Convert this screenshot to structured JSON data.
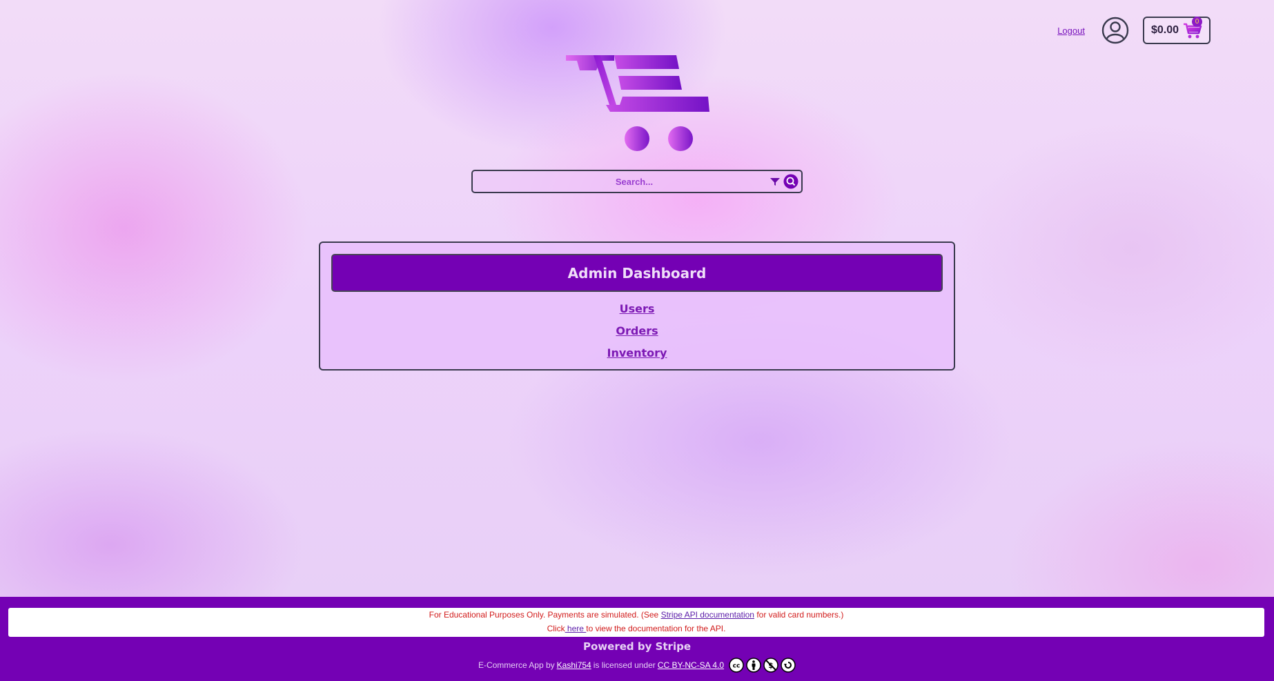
{
  "header": {
    "logout_label": "Logout",
    "cart_total": "$0.00",
    "cart_count": "0"
  },
  "search": {
    "placeholder": "Search..."
  },
  "dashboard": {
    "title": "Admin Dashboard",
    "links": [
      "Users",
      "Orders",
      "Inventory"
    ]
  },
  "footer": {
    "notice_prefix": "For Educational Purposes Only. Payments are simulated. (See ",
    "notice_link": "Stripe API documentation",
    "notice_suffix": " for valid card numbers.)",
    "click_prefix": "Click",
    "here_link": " here ",
    "click_suffix": "to view the documentation for the API.",
    "powered_by": "Powered by Stripe",
    "license_prefix": "E-Commerce App by",
    "author_link": " Kashi754 ",
    "license_mid": "is licensed under",
    "license_link": "CC BY-NC-SA 4.0 "
  },
  "colors": {
    "brand_purple": "#7401b4",
    "notice_red": "#d11a1a",
    "link_purple": "#7c19b4"
  }
}
